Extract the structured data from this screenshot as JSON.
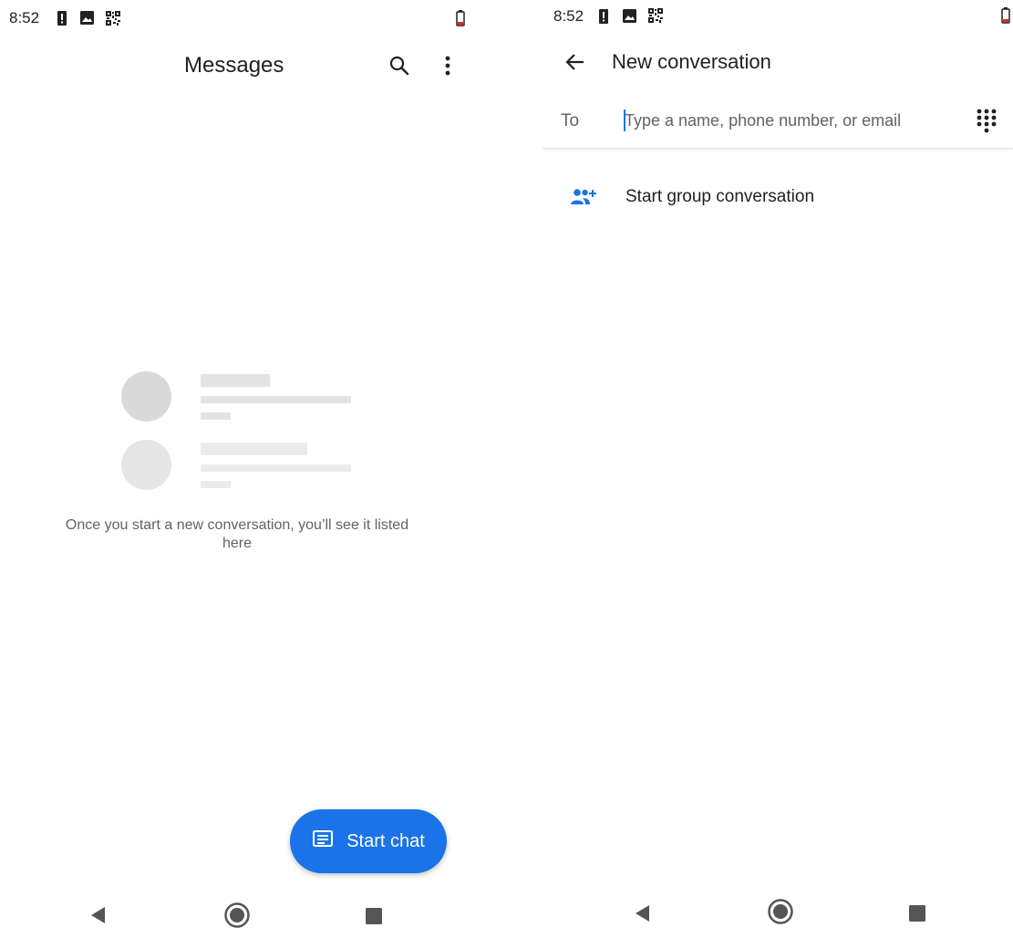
{
  "left_screen": {
    "status_bar": {
      "time": "8:52",
      "icons": [
        "alert-icon",
        "image-icon",
        "qr-code-icon",
        "battery-icon"
      ]
    },
    "toolbar": {
      "title": "Messages",
      "icons": [
        "search-icon",
        "more-vert-icon"
      ]
    },
    "empty_state": {
      "message": "Once you start a new conversation, you’ll see it listed here"
    },
    "fab": {
      "label": "Start chat",
      "icon": "chat-icon"
    },
    "nav_bar": [
      "back-icon",
      "home-icon",
      "recents-icon"
    ]
  },
  "right_screen": {
    "status_bar": {
      "time": "8:52",
      "icons": [
        "alert-icon",
        "image-icon",
        "qr-code-icon",
        "battery-icon"
      ]
    },
    "toolbar": {
      "title": "New conversation",
      "icons": [
        "arrow-back-icon"
      ]
    },
    "recipient": {
      "label": "To",
      "placeholder": "Type a name, phone number, or email",
      "value": "",
      "icon": "dialpad-icon"
    },
    "group_option": {
      "label": "Start group conversation",
      "icon": "group-add-icon"
    },
    "nav_bar": [
      "back-icon",
      "home-icon",
      "recents-icon"
    ]
  },
  "colors": {
    "accent": "#1a73e8",
    "text_primary": "#202124",
    "text_secondary": "#5f6368",
    "placeholder_gray": "#e3e3e3",
    "battery_red": "#d93025"
  }
}
